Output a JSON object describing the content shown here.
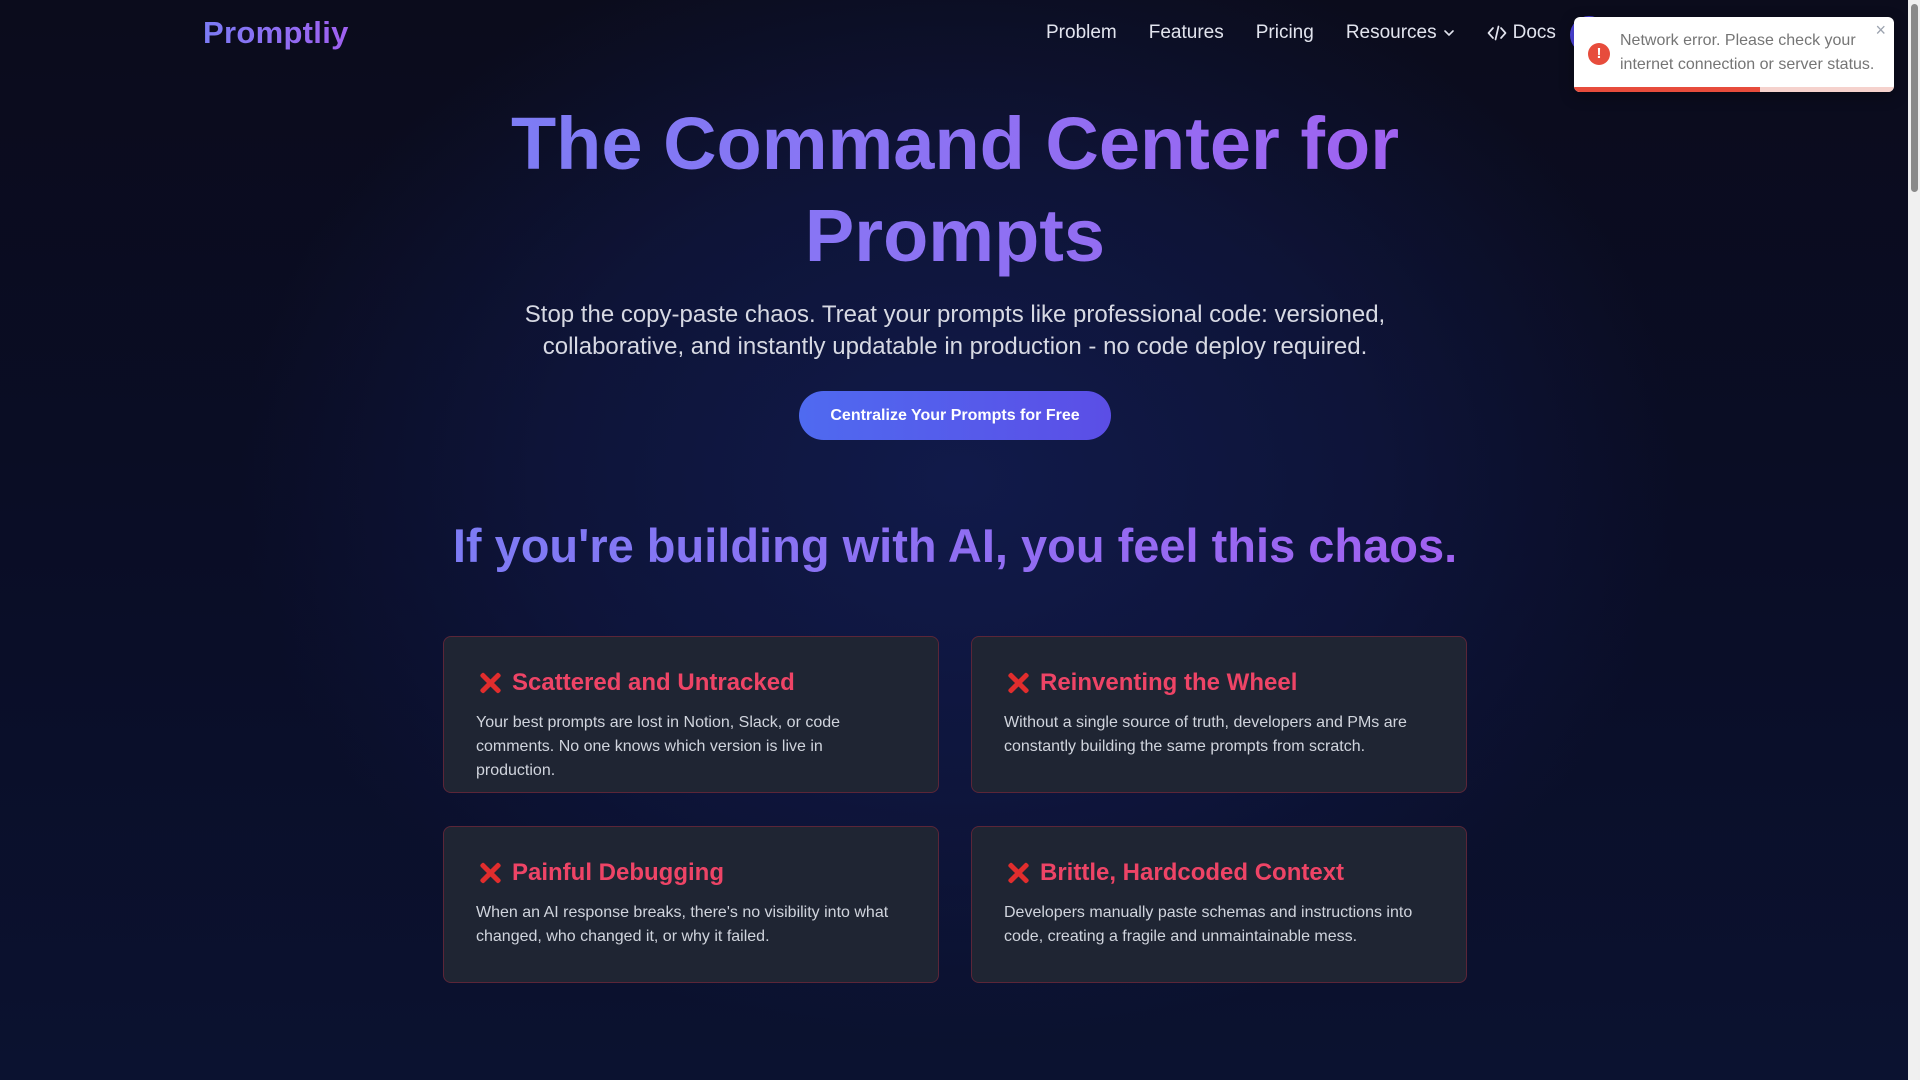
{
  "header": {
    "logo": "Promptliy",
    "nav": {
      "problem": "Problem",
      "features": "Features",
      "pricing": "Pricing",
      "resources": "Resources",
      "docs": "Docs"
    }
  },
  "toast": {
    "message": "Network error. Please check your internet connection or server status.",
    "close": "×",
    "icon": "!",
    "progress_fraction": 0.58
  },
  "hero": {
    "title": "The Command Center for Prompts",
    "subtitle": "Stop the copy-paste chaos. Treat your prompts like professional code: versioned, collaborative, and instantly updatable in production - no code deploy required.",
    "cta": "Centralize Your Prompts for Free"
  },
  "problem": {
    "title": "If you're building with AI, you feel this chaos.",
    "cards": [
      {
        "title": "Scattered and Untracked",
        "text": "Your best prompts are lost in Notion, Slack, or code comments. No one knows which version is live in production."
      },
      {
        "title": "Reinventing the Wheel",
        "text": "Without a single source of truth, developers and PMs are constantly building the same prompts from scratch."
      },
      {
        "title": "Painful Debugging",
        "text": "When an AI response breaks, there's no visibility into what changed, who changed it, or why it failed."
      },
      {
        "title": "Brittle, Hardcoded Context",
        "text": "Developers manually paste schemas and instructions into code, creating a fragile and unmaintainable mess."
      }
    ]
  },
  "colors": {
    "accent": "#7c7cf5",
    "error": "#e74c3c",
    "card_title": "#ee4466"
  }
}
